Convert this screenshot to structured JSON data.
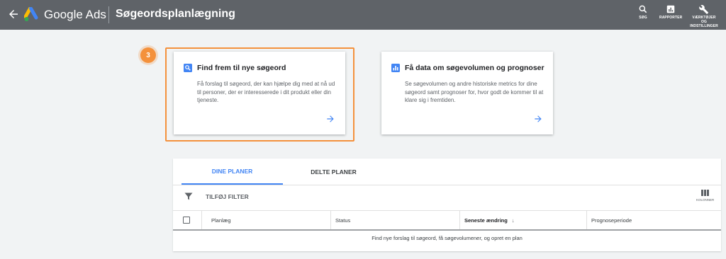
{
  "topbar": {
    "brand": "Google Ads",
    "title": "Søgeordsplanlægning",
    "tools": [
      {
        "icon": "search-icon",
        "label": "SØG"
      },
      {
        "icon": "reports-icon",
        "label": "RAPPORTER"
      },
      {
        "icon": "wrench-icon",
        "label": "VÆRKTØJER OG INDSTILLINGER"
      }
    ]
  },
  "step_badge": "3",
  "cards": [
    {
      "icon": "search-icon",
      "title": "Find frem til nye søgeord",
      "description": "Få forslag til søgeord, der kan hjælpe dig med at nå ud til personer, der er interesserede i dit produkt eller din tjeneste."
    },
    {
      "icon": "bar-chart-icon",
      "title": "Få data om søgevolumen og prognoser",
      "description": "Se søgevolumen og andre historiske metrics for dine søgeord samt prognoser for, hvor godt de kommer til at klare sig i fremtiden."
    }
  ],
  "plans": {
    "tabs": [
      "DINE PLANER",
      "DELTE PLANER"
    ],
    "active_tab": "DINE PLANER",
    "filter_label": "TILFØJ FILTER",
    "columns_label": "KOLONNER",
    "headers": [
      "Planlæg",
      "Status",
      "Seneste ændring",
      "Prognoseperiode"
    ],
    "sort_indicator": "↓",
    "empty_message": "Find nye forslag til søgeord, få søgevolumener, og opret en plan"
  },
  "colors": {
    "topbar": "#5f6368",
    "accent": "#4285f4",
    "highlight": "#f4913c",
    "background": "#f1f3f4"
  }
}
